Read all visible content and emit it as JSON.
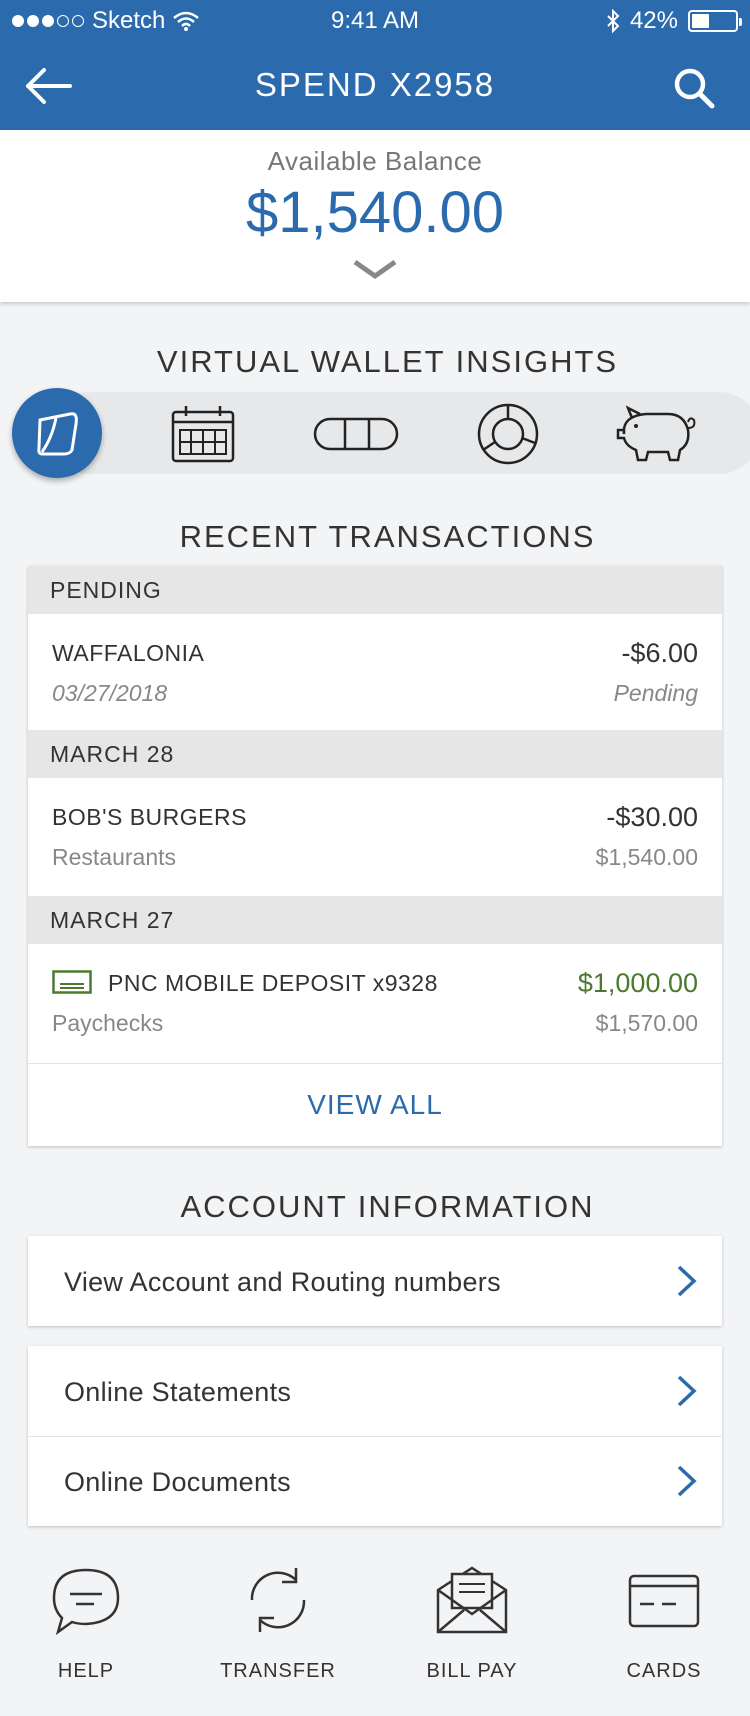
{
  "status_bar": {
    "carrier": "Sketch",
    "time": "9:41 AM",
    "battery": "42%"
  },
  "header": {
    "title": "SPEND X2958"
  },
  "balance": {
    "label": "Available Balance",
    "amount": "$1,540.00"
  },
  "insights": {
    "heading": "VIRTUAL WALLET INSIGHTS",
    "icons": [
      "wallet-icon",
      "calendar-icon",
      "toggle-pill-icon",
      "donut-chart-icon",
      "piggy-bank-icon"
    ]
  },
  "transactions": {
    "heading": "RECENT TRANSACTIONS",
    "groups": [
      {
        "label": "PENDING",
        "items": [
          {
            "name": "WAFFALONIA",
            "sub": "03/27/2018",
            "amount": "-$6.00",
            "balance": "Pending"
          }
        ]
      },
      {
        "label": "MARCH 28",
        "items": [
          {
            "name": "BOB'S BURGERS",
            "sub": "Restaurants",
            "amount": "-$30.00",
            "balance": "$1,540.00"
          }
        ]
      },
      {
        "label": "MARCH 27",
        "items": [
          {
            "name": "PNC MOBILE DEPOSIT x9328",
            "sub": "Paychecks",
            "amount": "$1,000.00",
            "balance": "$1,570.00"
          }
        ]
      }
    ],
    "view_all": "VIEW ALL"
  },
  "account_info": {
    "heading": "ACCOUNT INFORMATION",
    "items": [
      "View Account and Routing numbers",
      "Online Statements",
      "Online Documents"
    ]
  },
  "bottom_nav": [
    "HELP",
    "TRANSFER",
    "BILL PAY",
    "CARDS"
  ],
  "colors": {
    "primary": "#2b6aad",
    "deposit_green": "#4b7a2e",
    "background": "#f3f4f6"
  }
}
